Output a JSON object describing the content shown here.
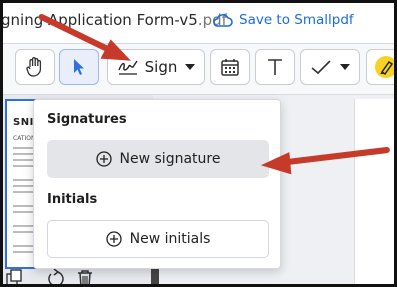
{
  "titlebar": {
    "doc_title": "gning Application Form-v5",
    "doc_ext": ".pdf",
    "save_link": "Save to Smallpdf"
  },
  "toolbar": {
    "sign_label": "Sign",
    "icons": [
      "pan-icon",
      "select-cursor-icon",
      "signature-icon",
      "calendar-icon",
      "text-icon",
      "checkmark-icon",
      "highlighter-icon"
    ]
  },
  "popup": {
    "signatures_heading": "Signatures",
    "new_signature_label": "New signature",
    "initials_heading": "Initials",
    "new_initials_label": "New initials"
  },
  "thumbnail": {
    "logo_text": "SNIP",
    "heading_text": "CATION FORM"
  },
  "colors": {
    "accent": "#1a6ed8",
    "arrow": "#c63a2a",
    "active_button": "#e8effb"
  }
}
